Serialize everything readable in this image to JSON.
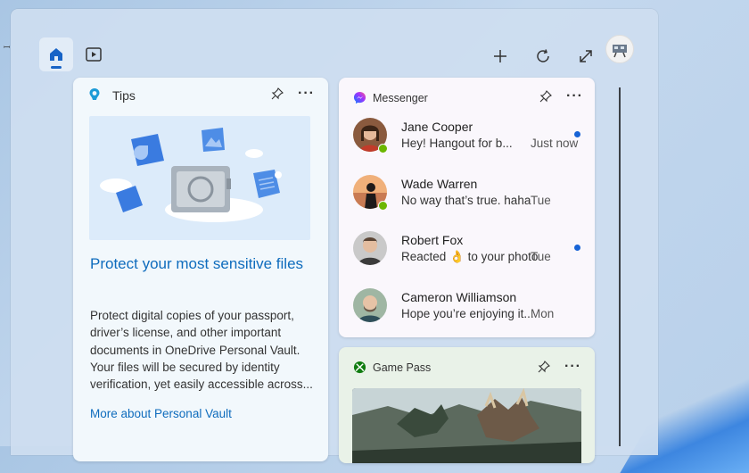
{
  "topbar": {
    "home_icon": "home-icon",
    "video_icon": "video-icon",
    "add_icon": "plus-icon",
    "refresh_icon": "refresh-icon",
    "expand_icon": "expand-icon",
    "accent": "#1763c6"
  },
  "tips": {
    "title": "Tips",
    "heading": "Protect your most sensitive files",
    "body": "Protect digital copies of your passport, driver’s license, and other important documents in OneDrive Personal Vault. Your files will be secured by identity verification, yet easily accessible across...",
    "link": "More about Personal Vault"
  },
  "messenger": {
    "title": "Messenger",
    "messages": [
      {
        "name": "Jane Cooper",
        "text": "Hey! Hangout for b...",
        "time": "Just now",
        "unread": true,
        "online": true
      },
      {
        "name": "Wade Warren",
        "text": "No way that’s true. haha",
        "time": "Tue",
        "unread": false,
        "online": true
      },
      {
        "name": "Robert Fox",
        "text": "Reacted 👌 to your photo",
        "time": "Tue",
        "unread": true,
        "online": false
      },
      {
        "name": "Cameron Williamson",
        "text": "Hope you’re enjoying it...",
        "time": "Mon",
        "unread": false,
        "online": false
      }
    ]
  },
  "gamepass": {
    "title": "Game Pass"
  },
  "colors": {
    "link_blue": "#0f6cbd",
    "unread_dot": "#1763d6",
    "presence_green": "#6bb700"
  }
}
